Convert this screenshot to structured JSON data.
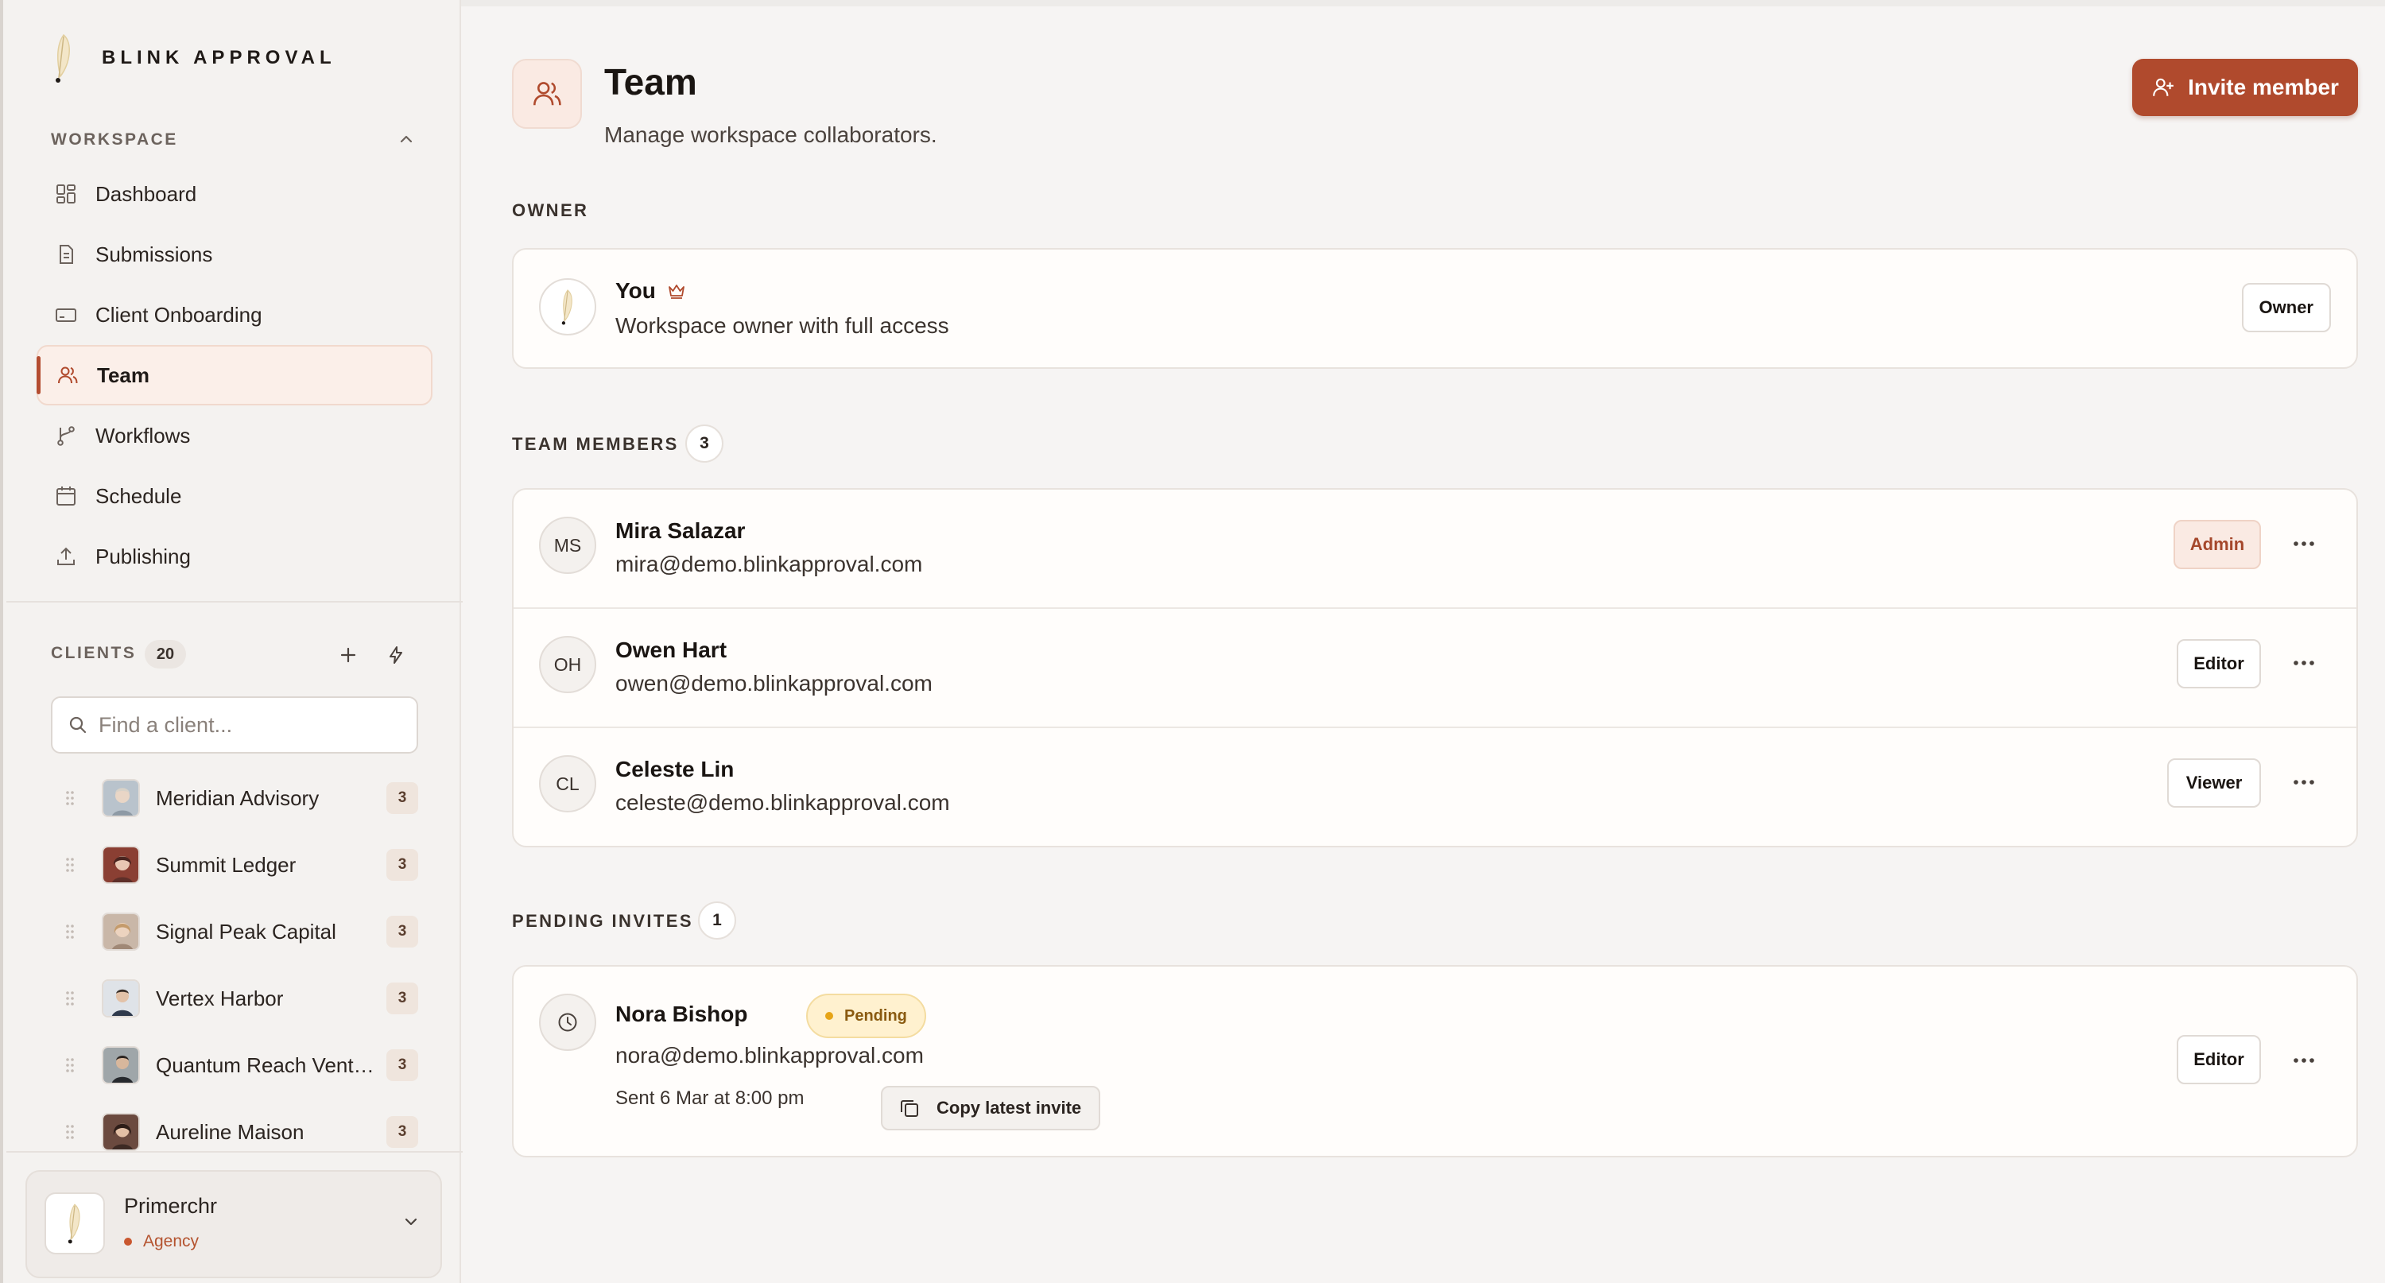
{
  "brand": {
    "name": "BLINK APPROVAL"
  },
  "sidebar": {
    "workspace_label": "WORKSPACE",
    "nav": [
      {
        "label": "Dashboard",
        "icon": "dashboard-icon"
      },
      {
        "label": "Submissions",
        "icon": "document-icon"
      },
      {
        "label": "Client Onboarding",
        "icon": "card-icon"
      },
      {
        "label": "Team",
        "icon": "users-icon",
        "active": true
      },
      {
        "label": "Workflows",
        "icon": "branch-icon"
      },
      {
        "label": "Schedule",
        "icon": "calendar-icon"
      },
      {
        "label": "Publishing",
        "icon": "upload-icon"
      }
    ],
    "clients_label": "CLIENTS",
    "clients_count": "20",
    "search_placeholder": "Find a client...",
    "clients": [
      {
        "name": "Meridian Advisory",
        "count": "3"
      },
      {
        "name": "Summit Ledger",
        "count": "3"
      },
      {
        "name": "Signal Peak Capital",
        "count": "3"
      },
      {
        "name": "Vertex Harbor",
        "count": "3"
      },
      {
        "name": "Quantum Reach Ventures",
        "count": "3"
      },
      {
        "name": "Aureline Maison",
        "count": "3"
      }
    ],
    "account": {
      "name": "Primerchr",
      "type": "Agency"
    }
  },
  "main": {
    "title": "Team",
    "subtitle": "Manage workspace collaborators.",
    "invite_label": "Invite member",
    "owner_section": {
      "label": "OWNER",
      "name": "You",
      "description": "Workspace owner with full access",
      "role": "Owner"
    },
    "members_section": {
      "label": "TEAM MEMBERS",
      "count": "3",
      "members": [
        {
          "initials": "MS",
          "name": "Mira Salazar",
          "email": "mira@demo.blinkapproval.com",
          "role": "Admin"
        },
        {
          "initials": "OH",
          "name": "Owen Hart",
          "email": "owen@demo.blinkapproval.com",
          "role": "Editor"
        },
        {
          "initials": "CL",
          "name": "Celeste Lin",
          "email": "celeste@demo.blinkapproval.com",
          "role": "Viewer"
        }
      ]
    },
    "pending_section": {
      "label": "PENDING INVITES",
      "count": "1",
      "invite": {
        "name": "Nora Bishop",
        "status": "Pending",
        "email": "nora@demo.blinkapproval.com",
        "sent": "Sent 6 Mar at 8:00 pm",
        "copy_label": "Copy latest invite",
        "role": "Editor"
      }
    }
  },
  "colors": {
    "accent": "#b04a2d",
    "pending": "#e6a417",
    "background": "#f6f4f3"
  }
}
